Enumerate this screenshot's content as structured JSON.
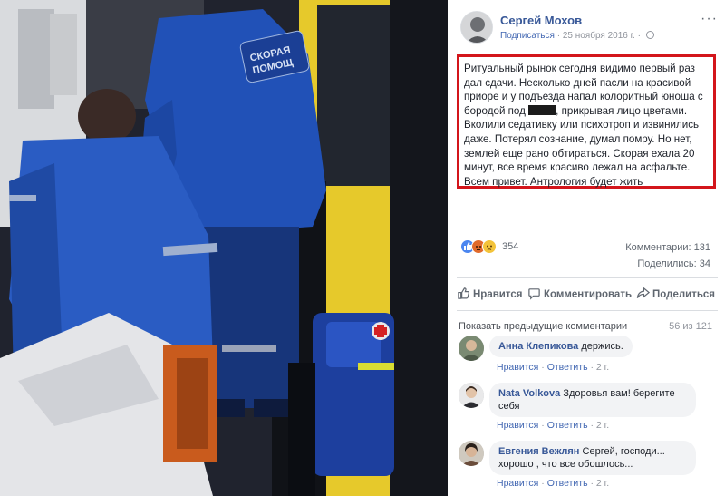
{
  "post": {
    "author": "Сергей Мохов",
    "subscribe": "Подписаться",
    "date": "25 ноября 2016 г.",
    "more_menu": "···",
    "text_lines": {
      "l1": "Ритуальный рынок сегодня видимо первый раз",
      "l2": "дал сдачи. Несколько дней пасли на красивой",
      "l3": "приоре и у подъезда напал колоритный юноша с",
      "l4a": "бородой под",
      "l4b": ", прикрывая лицо цветами.",
      "l5": "Вколили седативку или психотроп и извинились",
      "l6": "даже. Потерял сознание, думал помру. Но нет,",
      "l7": "землей еще рано обтираться. Скорая ехала 20",
      "l8": "минут, все время красиво лежал на асфальте.",
      "l9": "Всем привет. Антрология будет жить"
    },
    "reactions_count": "354",
    "comments_count": "Комментарии: 131",
    "shares_count": "Поделились: 34",
    "reaction_icons": [
      "like-icon",
      "angry-icon",
      "sad-icon"
    ]
  },
  "photo": {
    "jacket_text": "СКОРАЯ ПОМОЩ"
  },
  "actions": {
    "like": "Нравится",
    "comment": "Комментировать",
    "share": "Поделиться"
  },
  "comments_header": {
    "show_previous": "Показать предыдущие комментарии",
    "count": "56 из 121"
  },
  "comments": [
    {
      "author": "Анна Клепикова",
      "text": "держись.",
      "like": "Нравится",
      "reply": "Ответить",
      "age": "2 г."
    },
    {
      "author": "Nata Volkova",
      "text": "Здоровья вам! берегите себя",
      "like": "Нравится",
      "reply": "Ответить",
      "age": "2 г."
    },
    {
      "author": "Евгения Вежлян",
      "text": "Сергей, господи... хорошо , что все обошлось...",
      "like": "Нравится",
      "reply": "Ответить",
      "age": "2 г."
    }
  ],
  "colors": {
    "link": "#385898",
    "highlight_border": "#d3151b",
    "uniform_blue": "#1f4fb8"
  }
}
